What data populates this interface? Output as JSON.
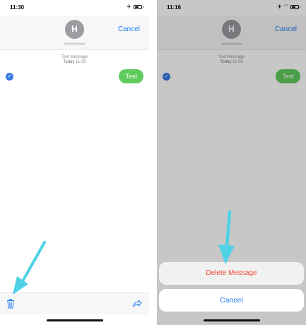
{
  "left_screen": {
    "status_time": "11:30",
    "avatar_initial": "H",
    "contact_name": "Hamza Husayne",
    "cancel_label": "Cancel",
    "meta_label": "Text Message",
    "meta_date": "Today",
    "meta_time": "11:30",
    "message_text": "Test",
    "icons": [
      "airplane-icon",
      "battery-icon",
      "check-icon",
      "trash-icon",
      "share-icon"
    ]
  },
  "right_screen": {
    "status_time": "11:16",
    "avatar_initial": "H",
    "contact_name": "Hamza Husayne",
    "cancel_link_label": "Cancel",
    "meta_label": "Text Message",
    "meta_date": "Today",
    "meta_time": "11:09",
    "message_text": "Test",
    "delete_label": "Delete Message",
    "cancel_button_label": "Cancel",
    "icons": [
      "airplane-icon",
      "wifi-icon",
      "battery-icon",
      "check-icon"
    ]
  },
  "colors": {
    "accent_blue": "#1e7cf2",
    "bubble_green": "#5fcb5c",
    "delete_red": "#ee4b37",
    "arrow_cyan": "#4fd2e6"
  }
}
